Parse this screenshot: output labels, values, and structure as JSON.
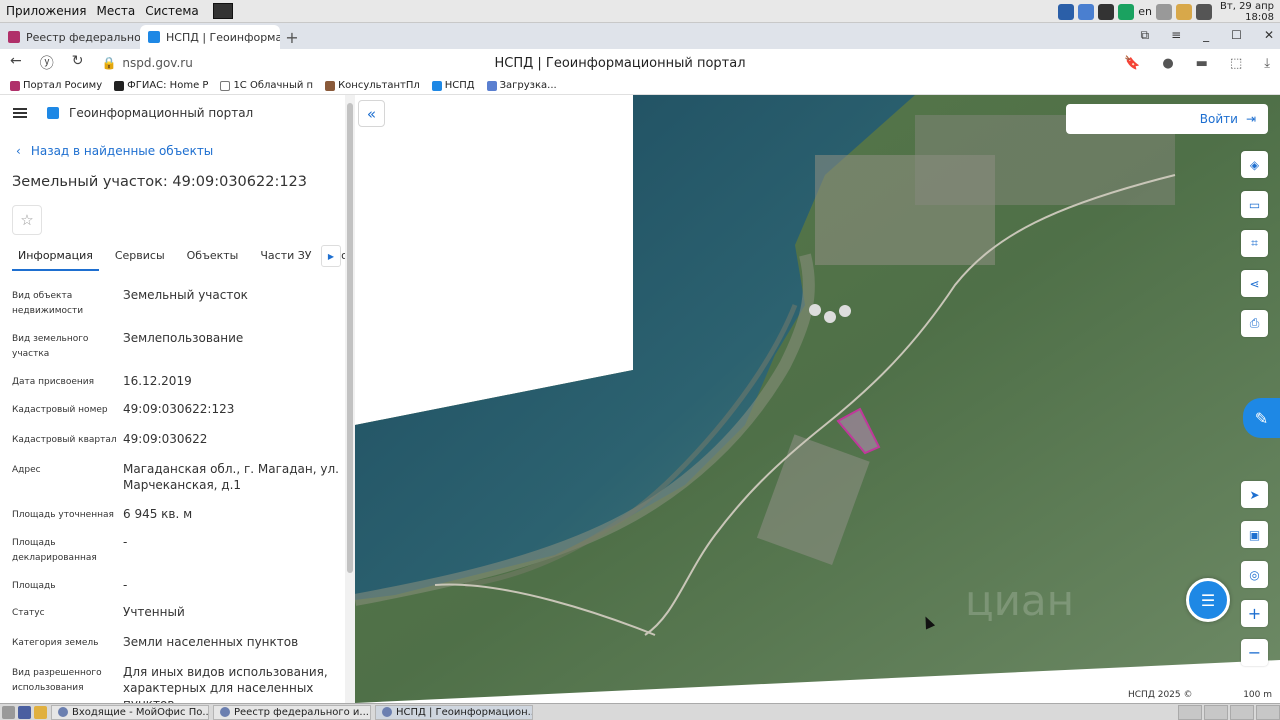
{
  "system_bar": {
    "menus": [
      "Приложения",
      "Места",
      "Система"
    ],
    "layout_lang": "en",
    "clock_line1": "Вт, 29 апр",
    "clock_line2": "18:08"
  },
  "browser": {
    "tabs": [
      {
        "label": "Реестр федерального",
        "active": false
      },
      {
        "label": "НСПД | Геоинформа",
        "active": true
      }
    ],
    "url": "nspd.gov.ru",
    "page_title": "НСПД | Геоинформационный портал",
    "bookmarks": [
      "Портал Росиму",
      "ФГИАС: Home P",
      "1С Облачный п",
      "КонсультантПл",
      "НСПД",
      "Загрузка..."
    ]
  },
  "panel": {
    "portal_title": "Геоинформационный портал",
    "back_link": "Назад в найденные объекты",
    "object_title": "Земельный участок: 49:09:030622:123",
    "tabs": [
      "Информация",
      "Сервисы",
      "Объекты",
      "Части ЗУ",
      "Соста"
    ],
    "active_tab": "Информация",
    "properties": [
      {
        "label": "Вид объекта недвижимости",
        "value": "Земельный участок"
      },
      {
        "label": "Вид земельного участка",
        "value": "Землепользование"
      },
      {
        "label": "Дата присвоения",
        "value": "16.12.2019"
      },
      {
        "label": "Кадастровый номер",
        "value": "49:09:030622:123"
      },
      {
        "label": "Кадастровый квартал",
        "value": "49:09:030622"
      },
      {
        "label": "Адрес",
        "value": "Магаданская обл., г. Магадан, ул. Марчеканская, д.1"
      },
      {
        "label": "Площадь уточненная",
        "value": "6 945 кв. м"
      },
      {
        "label": "Площадь декларированная",
        "value": "-"
      },
      {
        "label": "Площадь",
        "value": "-"
      },
      {
        "label": "Статус",
        "value": "Учтенный"
      },
      {
        "label": "Категория земель",
        "value": "Земли населенных пунктов"
      },
      {
        "label": "Вид разрешенного использования",
        "value": "Для иных видов использования, характерных для населенных пунктов"
      }
    ]
  },
  "map": {
    "login_label": "Войти",
    "attribution": "НСПД 2025 ©",
    "scale": "100 m",
    "parcel_color": "#c0399b"
  },
  "taskbar": {
    "items": [
      "Входящие - МойОфис По...",
      "Реестр федерального и...",
      "НСПД | Геоинформацион..."
    ],
    "active_index": 2
  }
}
